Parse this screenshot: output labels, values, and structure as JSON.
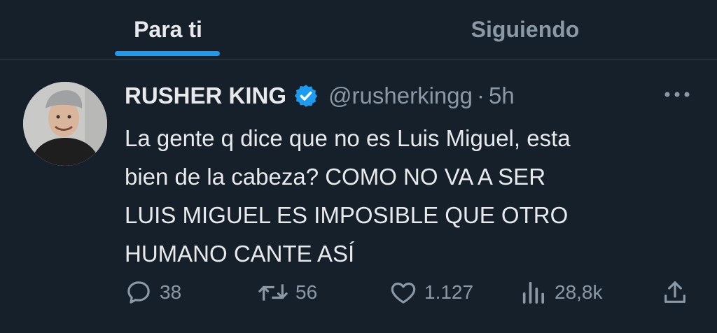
{
  "tabs": [
    {
      "label": "Para ti",
      "active": true
    },
    {
      "label": "Siguiendo",
      "active": false
    }
  ],
  "tweet": {
    "display_name": "RUSHER KING",
    "verified": true,
    "handle": "@rusherkingg",
    "separator": "·",
    "time": "5h",
    "text_lines": [
      "La gente q dice que no es Luis Miguel, esta",
      "bien de la cabeza? COMO NO VA A SER",
      "LUIS MIGUEL ES IMPOSIBLE QUE OTRO",
      "HUMANO CANTE ASÍ"
    ],
    "actions": {
      "replies": "38",
      "retweets": "56",
      "likes": "1.127",
      "views": "28,8k"
    }
  },
  "icons": {
    "verified": "verified-badge-icon",
    "more": "more-icon",
    "reply": "reply-icon",
    "retweet": "retweet-icon",
    "like": "heart-icon",
    "views": "views-icon",
    "share": "share-icon"
  },
  "colors": {
    "background": "#15202b",
    "accent": "#1d9bf0",
    "text": "#e7e9ea",
    "muted": "#8b98a5",
    "divider": "#38444d"
  }
}
